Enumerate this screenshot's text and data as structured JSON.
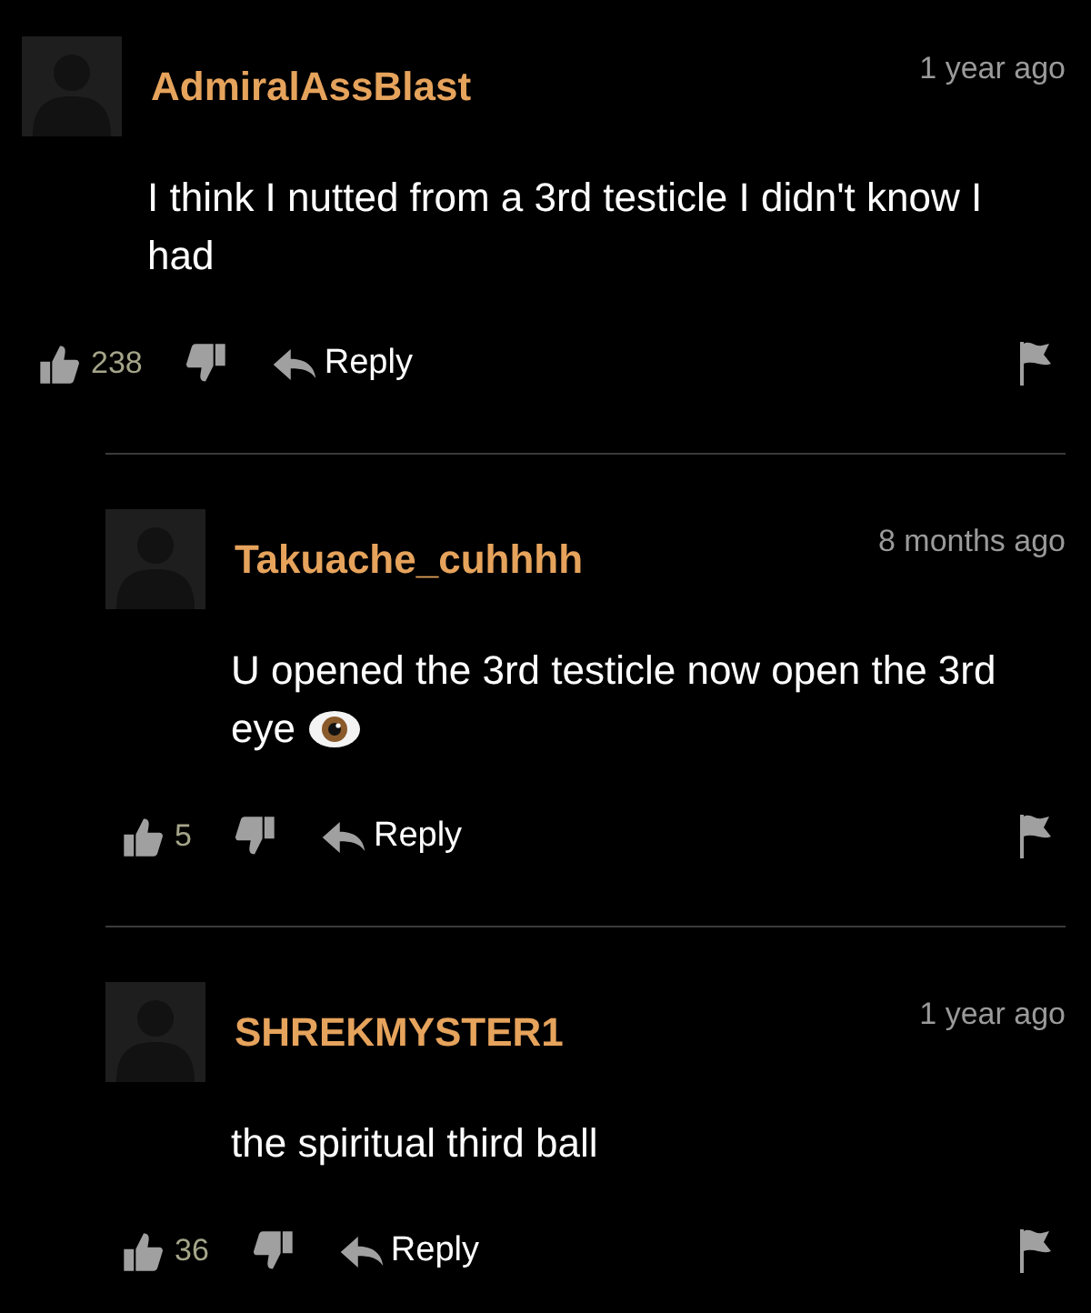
{
  "comments": [
    {
      "username": "AdmiralAssBlast",
      "time": "1 year ago",
      "body": "I think I nutted from a 3rd testicle I didn't know I had",
      "likes": "238",
      "reply_label": "Reply",
      "children": [
        {
          "username": "Takuache_cuhhhh",
          "time": "8 months ago",
          "body": "U opened the 3rd testicle now open the 3rd eye",
          "trailing_icon": true,
          "likes": "5",
          "reply_label": "Reply"
        },
        {
          "username": "SHREKMYSTER1",
          "time": "1 year ago",
          "body": "the spiritual third ball",
          "likes": "36",
          "reply_label": "Reply"
        }
      ]
    }
  ]
}
